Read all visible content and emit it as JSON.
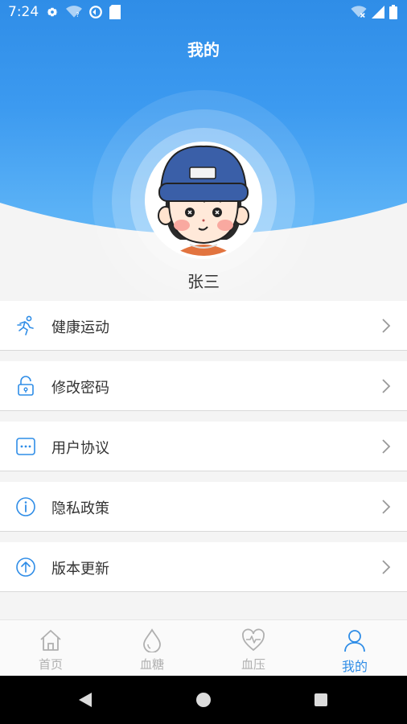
{
  "status": {
    "time": "7:24"
  },
  "header": {
    "title": "我的"
  },
  "profile": {
    "name": "张三"
  },
  "menu": [
    {
      "label": "健康运动",
      "icon": "running-person-icon"
    },
    {
      "label": "修改密码",
      "icon": "lock-icon"
    },
    {
      "label": "用户协议",
      "icon": "chat-dots-icon"
    },
    {
      "label": "隐私政策",
      "icon": "info-icon"
    },
    {
      "label": "版本更新",
      "icon": "upload-arrow-icon"
    }
  ],
  "tabs": [
    {
      "label": "首页",
      "icon": "home-icon",
      "active": false
    },
    {
      "label": "血糖",
      "icon": "drop-icon",
      "active": false
    },
    {
      "label": "血压",
      "icon": "heart-pulse-icon",
      "active": false
    },
    {
      "label": "我的",
      "icon": "user-icon",
      "active": true
    }
  ],
  "colors": {
    "primary": "#2f8de7",
    "inactive": "#b0b0b0",
    "text": "#333333"
  }
}
